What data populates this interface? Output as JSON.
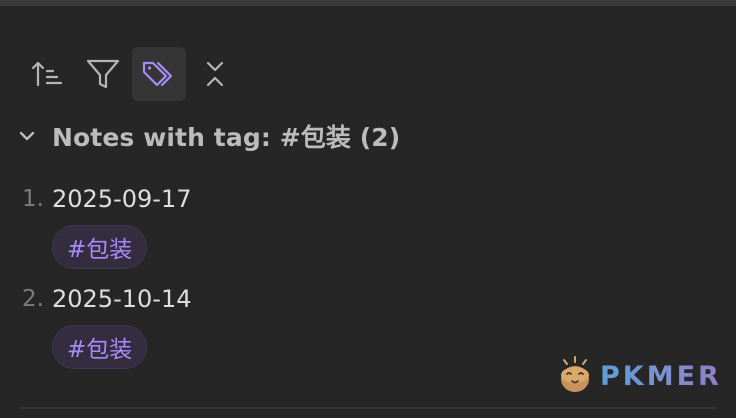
{
  "toolbar": {
    "buttons": [
      {
        "icon": "sort-icon",
        "active": false
      },
      {
        "icon": "filter-icon",
        "active": false
      },
      {
        "icon": "tags-icon",
        "active": true
      },
      {
        "icon": "collapse-icon",
        "active": false
      }
    ]
  },
  "section": {
    "title": "Notes with tag: #包装 (2)",
    "collapse_icon": "chevron-down-icon"
  },
  "results": [
    {
      "number": "1.",
      "title": "2025-09-17",
      "tag": "#包装"
    },
    {
      "number": "2.",
      "title": "2025-10-14",
      "tag": "#包装"
    }
  ],
  "watermark": {
    "text": "PKMER",
    "logo": "egg-mascot-logo"
  },
  "colors": {
    "background": "#262626",
    "accent": "#a88bfa",
    "tag_background": "#342d40",
    "active_button": "#353535"
  }
}
